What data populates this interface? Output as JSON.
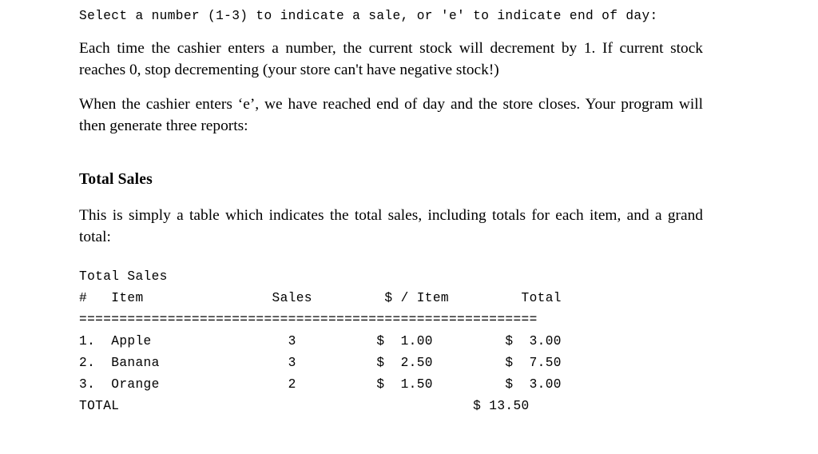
{
  "document": {
    "prompt_line": "Select a number (1-3) to indicate a sale, or 'e' to indicate end of day:",
    "paragraphs": [
      "Each time the cashier enters a number, the current stock will decrement by 1. If current stock reaches 0, stop decrementing (your store can't have negative stock!)",
      "When the cashier enters ‘e’, we have reached end of day and the store closes. Your program will then generate three reports:"
    ],
    "section": {
      "heading": "Total Sales",
      "description": "This is simply a table which indicates the total sales, including totals for each item, and a grand total:"
    },
    "report": {
      "title": "Total Sales",
      "header_line": "#   Item                Sales         $ / Item         Total",
      "separator_line": "=========================================================",
      "rows": [
        "1.  Apple                 3          $  1.00         $  3.00",
        "2.  Banana                3          $  2.50         $  7.50",
        "3.  Orange                2          $  1.50         $  3.00"
      ],
      "total_line": "TOTAL                                            $ 13.50"
    }
  },
  "table_data": {
    "type": "table",
    "title": "Total Sales",
    "columns": [
      "#",
      "Item",
      "Sales",
      "$ / Item",
      "Total"
    ],
    "rows": [
      {
        "num": "1.",
        "item": "Apple",
        "sales": 3,
        "price_per_item": "$  1.00",
        "total": "$  3.00"
      },
      {
        "num": "2.",
        "item": "Banana",
        "sales": 3,
        "price_per_item": "$  2.50",
        "total": "$  7.50"
      },
      {
        "num": "3.",
        "item": "Orange",
        "sales": 2,
        "price_per_item": "$  1.50",
        "total": "$  3.00"
      }
    ],
    "grand_total_label": "TOTAL",
    "grand_total_value": "$ 13.50"
  },
  "colors": {
    "text": "#000000",
    "background": "#ffffff"
  }
}
